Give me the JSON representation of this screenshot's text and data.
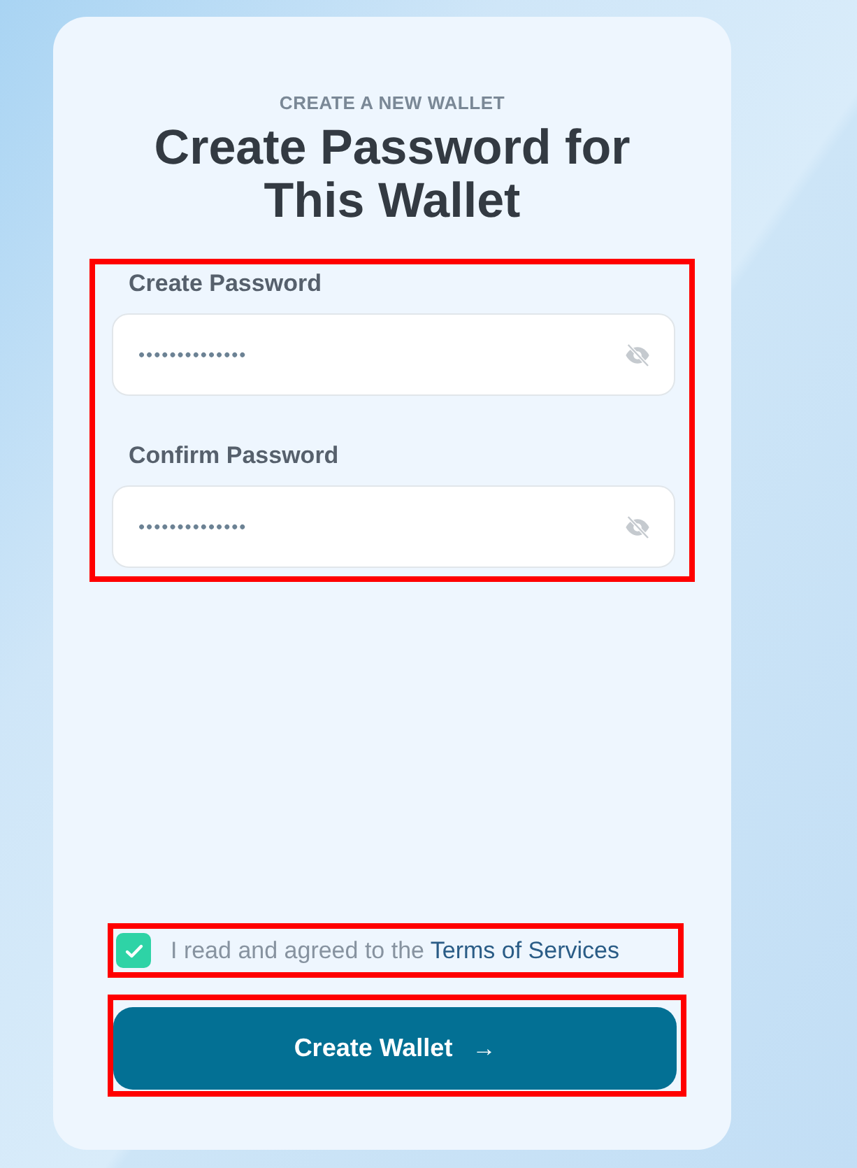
{
  "eyebrow": "CREATE A NEW WALLET",
  "title": "Create Password for This Wallet",
  "password_section": {
    "highlighted": true,
    "fields": [
      {
        "label": "Create Password",
        "value": "••••••••••••••"
      },
      {
        "label": "Confirm Password",
        "value": "••••••••••••••"
      }
    ]
  },
  "terms": {
    "highlighted": true,
    "checked": true,
    "text": "I read and agreed to the ",
    "link": "Terms of Services"
  },
  "submit": {
    "highlighted": true,
    "label": "Create Wallet",
    "icon": "→"
  }
}
